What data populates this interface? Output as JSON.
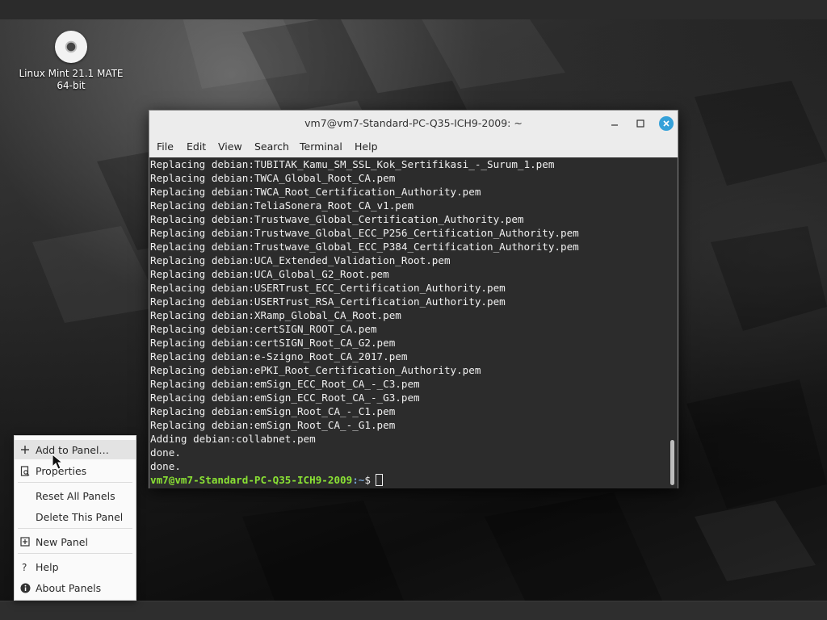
{
  "desktop": {
    "icon_label_line1": "Linux Mint 21.1 MATE",
    "icon_label_line2": "64-bit",
    "icon_name": "disc-icon"
  },
  "terminal": {
    "title": "vm7@vm7-Standard-PC-Q35-ICH9-2009: ~",
    "menu": [
      "File",
      "Edit",
      "View",
      "Search",
      "Terminal",
      "Help"
    ],
    "lines": [
      "Replacing debian:TUBITAK_Kamu_SM_SSL_Kok_Sertifikasi_-_Surum_1.pem",
      "Replacing debian:TWCA_Global_Root_CA.pem",
      "Replacing debian:TWCA_Root_Certification_Authority.pem",
      "Replacing debian:TeliaSonera_Root_CA_v1.pem",
      "Replacing debian:Trustwave_Global_Certification_Authority.pem",
      "Replacing debian:Trustwave_Global_ECC_P256_Certification_Authority.pem",
      "Replacing debian:Trustwave_Global_ECC_P384_Certification_Authority.pem",
      "Replacing debian:UCA_Extended_Validation_Root.pem",
      "Replacing debian:UCA_Global_G2_Root.pem",
      "Replacing debian:USERTrust_ECC_Certification_Authority.pem",
      "Replacing debian:USERTrust_RSA_Certification_Authority.pem",
      "Replacing debian:XRamp_Global_CA_Root.pem",
      "Replacing debian:certSIGN_ROOT_CA.pem",
      "Replacing debian:certSIGN_Root_CA_G2.pem",
      "Replacing debian:e-Szigno_Root_CA_2017.pem",
      "Replacing debian:ePKI_Root_Certification_Authority.pem",
      "Replacing debian:emSign_ECC_Root_CA_-_C3.pem",
      "Replacing debian:emSign_ECC_Root_CA_-_G3.pem",
      "Replacing debian:emSign_Root_CA_-_C1.pem",
      "Replacing debian:emSign_Root_CA_-_G1.pem",
      "Adding debian:collabnet.pem",
      "done.",
      "done."
    ],
    "prompt_user": "vm7@vm7-Standard-PC-Q35-ICH9-2009",
    "prompt_path": ":~",
    "prompt_symbol": "$",
    "colors": {
      "background": "#2c2c2c",
      "text": "#f0f0f0",
      "prompt_user": "#8ae234",
      "prompt_path": "#729fcf",
      "close_button": "#35a1d9"
    }
  },
  "context_menu": {
    "items": [
      {
        "label": "Add to Panel…",
        "icon": "plus-icon"
      },
      {
        "label": "Properties",
        "icon": "properties-icon"
      },
      {
        "label": "Reset All Panels",
        "icon": "reset-icon"
      },
      {
        "label": "Delete This Panel",
        "icon": "trash-icon"
      },
      {
        "label": "New Panel",
        "icon": "new-panel-icon"
      },
      {
        "label": "Help",
        "icon": "help-icon"
      },
      {
        "label": "About Panels",
        "icon": "info-icon"
      }
    ]
  }
}
